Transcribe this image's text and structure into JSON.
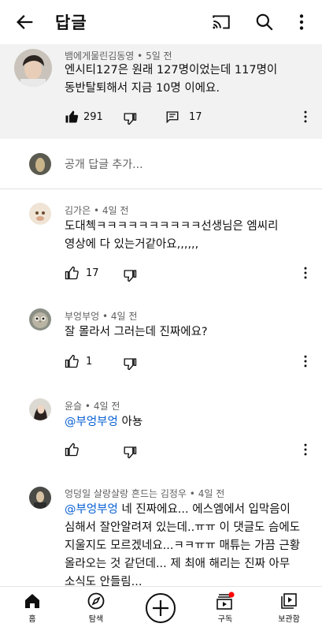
{
  "header": {
    "title": "답글"
  },
  "parent_comment": {
    "author": "뱀에게물린김동영",
    "time": "5일 전",
    "text_line1": "엔시티127은 원래 127명이었는데 117명이",
    "text_line2": "동반탈퇴해서 지금 10명 이에요.",
    "likes": "291",
    "replies": "17"
  },
  "add_reply": {
    "placeholder": "공개 답글 추가..."
  },
  "comments": [
    {
      "author": "김가은",
      "time": "4일 전",
      "text_line1": "도대첵ㅋㅋㅋㅋㅋㅋㅋㅋㅋㅋ선생님은 엠씨리",
      "text_line2": "영상에 다 있는거같아요,,,,,,",
      "likes": "17"
    },
    {
      "author": "부엉부엉",
      "time": "4일 전",
      "text_line1": "잘 몰라서 그러는데 진짜에요?",
      "likes": "1"
    },
    {
      "author": "윤슬",
      "time": "4일 전",
      "mention": "@부엉부엉",
      "text_line1": "아뇽"
    },
    {
      "author": "엉덩일 살랑살랑 흔드는 김정우",
      "time": "4일 전",
      "mention": "@부엉부엉",
      "text_line1": "네 진짜에요... 에스엠에서 입막음이",
      "text_line2": "심해서 잘안알려져 있는데..ㅠㅠ 이 댓글도 슴에도",
      "text_line3": "지울지도 모르겠네요...ㅋㅋㅠㅠ 매튜는 가끔 근황",
      "text_line4": "올라오는 것 같던데... 제 최애 해리는 진짜 아무",
      "text_line5": "소식도 안들림..."
    }
  ],
  "bottom_nav": {
    "home": "홈",
    "explore": "탐색",
    "subscriptions": "구독",
    "library": "보관함"
  },
  "colors": {
    "mention": "#065fd4",
    "notification_dot": "#ff0000",
    "parent_bg": "#f2f2f2"
  }
}
